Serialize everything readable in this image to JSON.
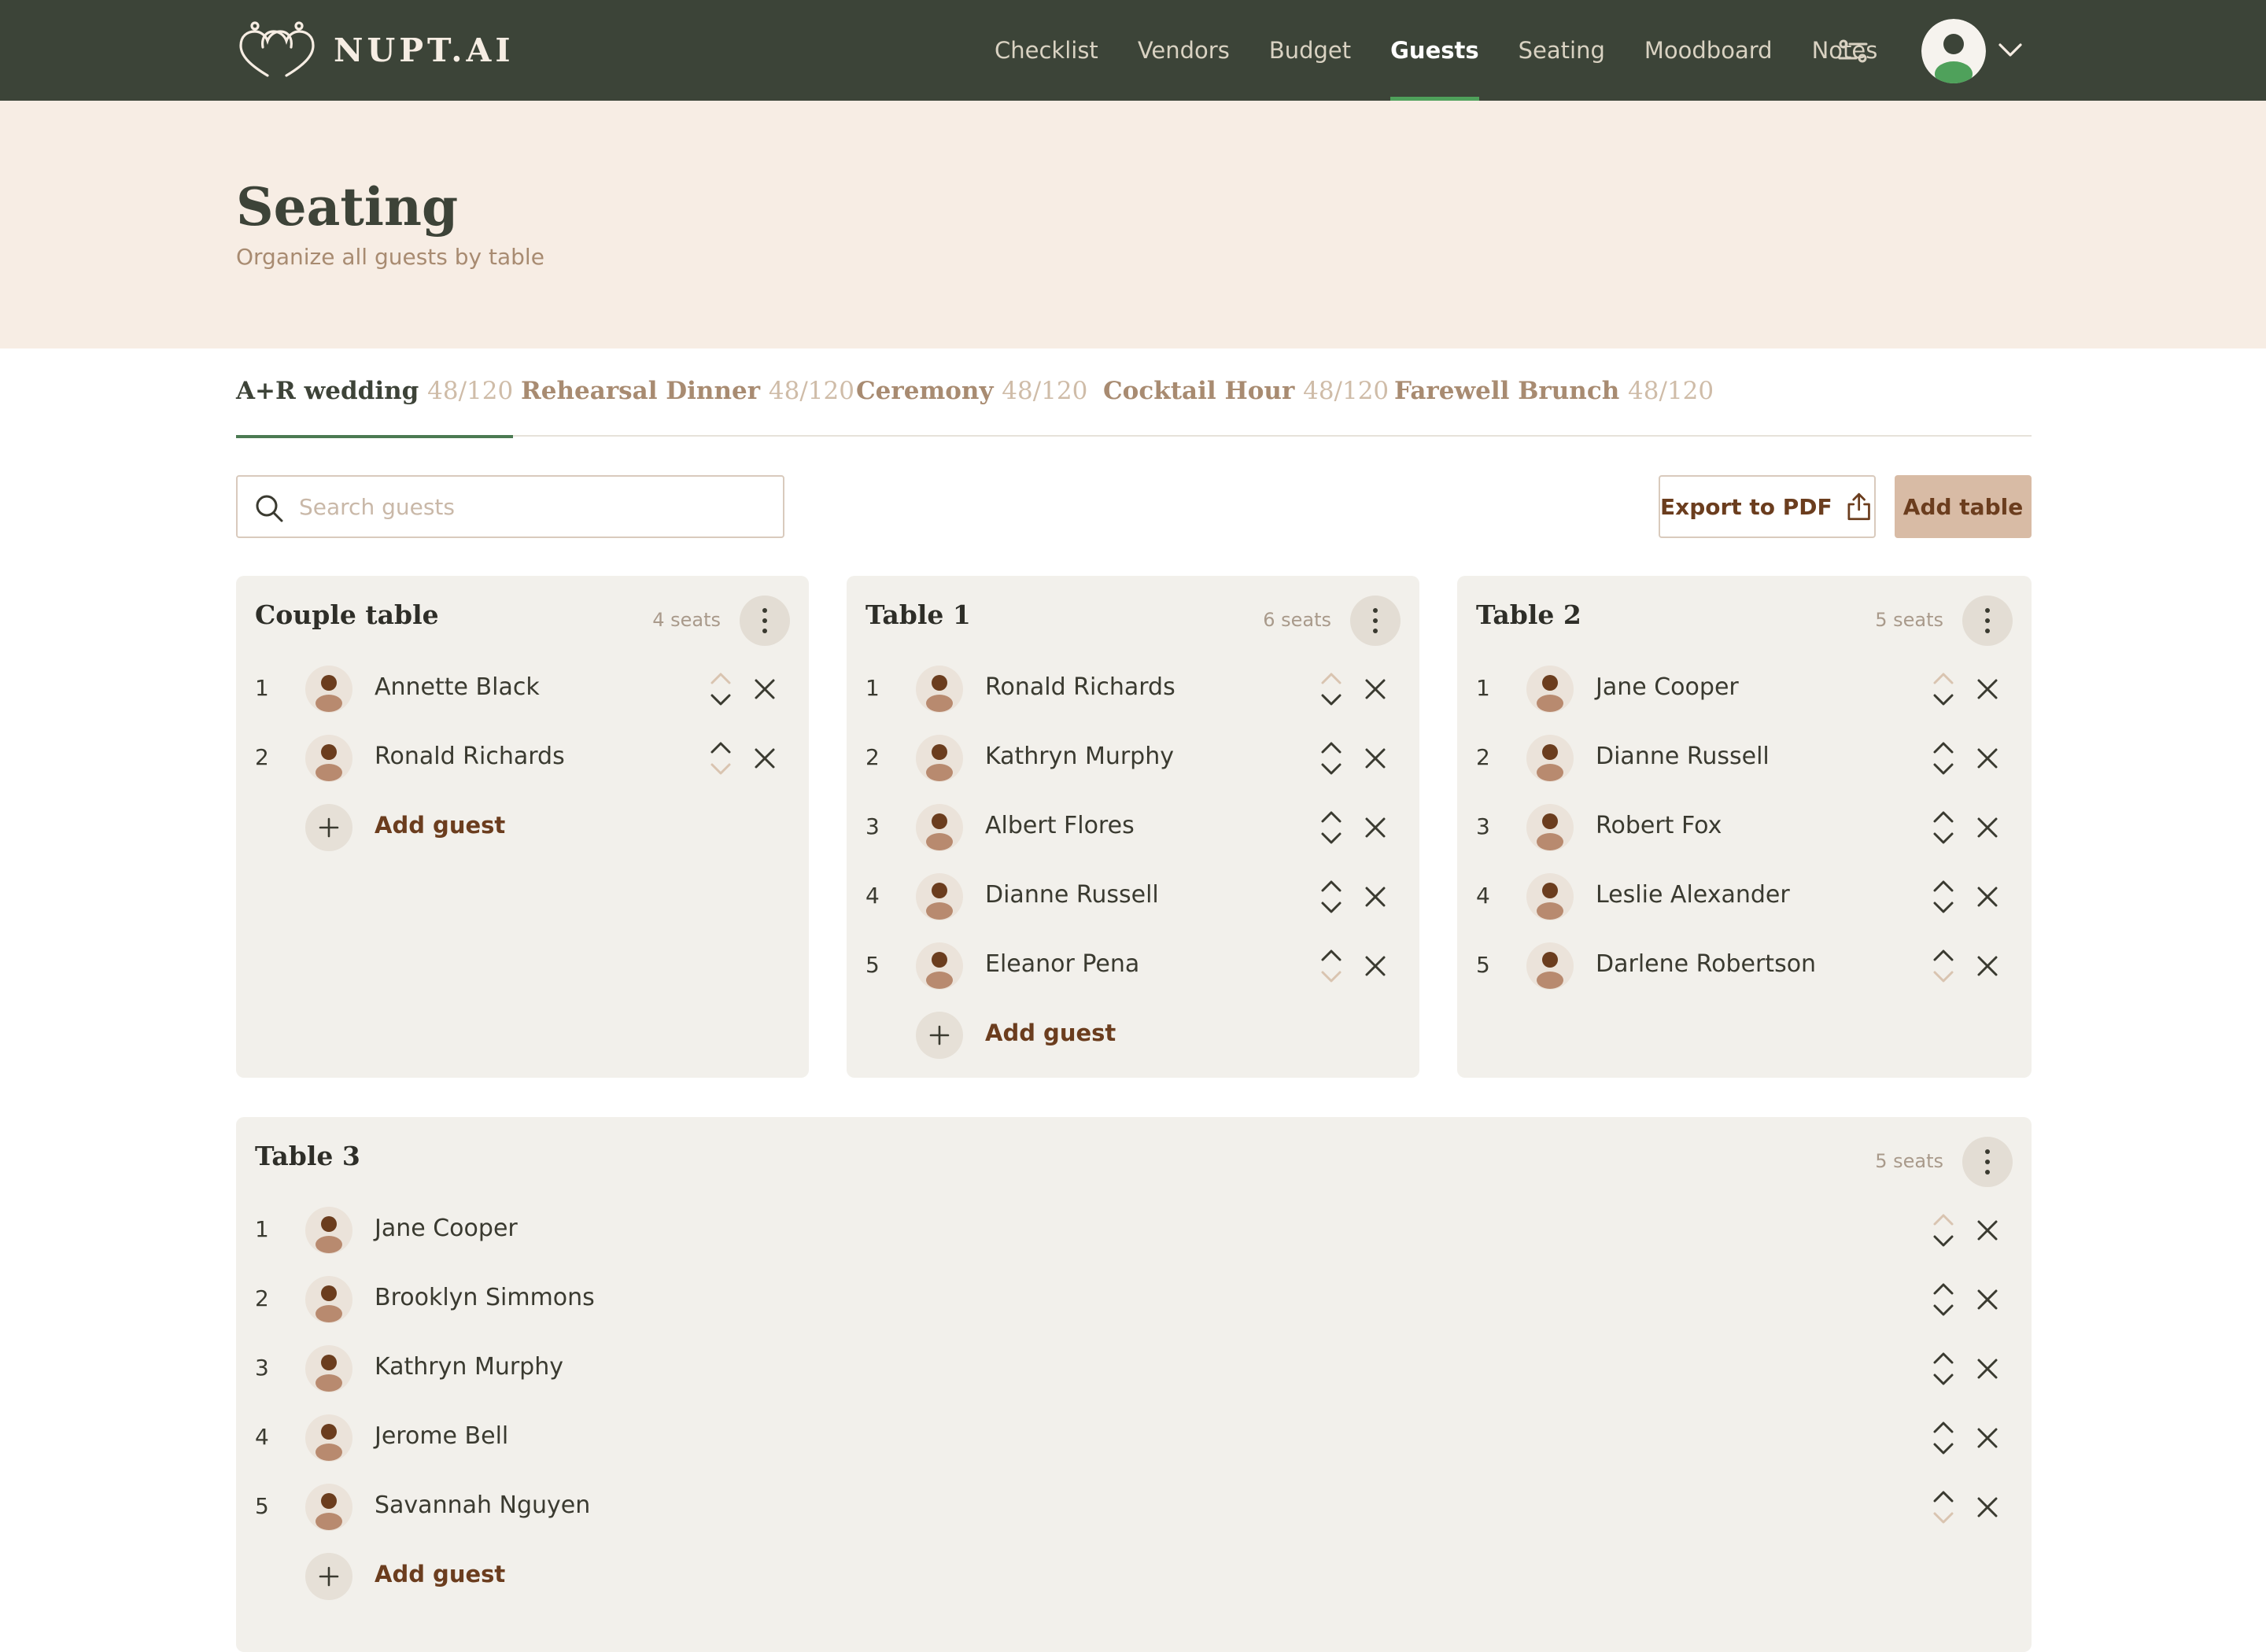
{
  "brand": {
    "name": "NUPT.AI"
  },
  "nav": {
    "items": [
      {
        "label": "Checklist",
        "active": false
      },
      {
        "label": "Vendors",
        "active": false
      },
      {
        "label": "Budget",
        "active": false
      },
      {
        "label": "Guests",
        "active": true
      },
      {
        "label": "Seating",
        "active": false
      },
      {
        "label": "Moodboard",
        "active": false
      },
      {
        "label": "Notes",
        "active": false
      }
    ]
  },
  "header": {
    "title": "Seating",
    "subtitle": "Organize all guests by table"
  },
  "tabs": [
    {
      "label": "A+R wedding",
      "count": "48/120",
      "active": true
    },
    {
      "label": "Rehearsal Dinner",
      "count": "48/120",
      "active": false
    },
    {
      "label": "Ceremony",
      "count": "48/120",
      "active": false
    },
    {
      "label": "Cocktail Hour",
      "count": "48/120",
      "active": false
    },
    {
      "label": "Farewell Brunch",
      "count": "48/120",
      "active": false
    }
  ],
  "toolbar": {
    "search_placeholder": "Search guests",
    "export_label": "Export to PDF",
    "add_table_label": "Add table"
  },
  "add_guest_label": "Add guest",
  "tables": [
    {
      "title": "Couple table",
      "seats": "4 seats",
      "guests": [
        {
          "num": "1",
          "name": "Annette Black"
        },
        {
          "num": "2",
          "name": "Ronald Richards"
        }
      ]
    },
    {
      "title": "Table 1",
      "seats": "6 seats",
      "guests": [
        {
          "num": "1",
          "name": "Ronald Richards"
        },
        {
          "num": "2",
          "name": "Kathryn Murphy"
        },
        {
          "num": "3",
          "name": "Albert Flores"
        },
        {
          "num": "4",
          "name": "Dianne Russell"
        },
        {
          "num": "5",
          "name": "Eleanor Pena"
        }
      ]
    },
    {
      "title": "Table 2",
      "seats": "5 seats",
      "guests": [
        {
          "num": "1",
          "name": "Jane Cooper"
        },
        {
          "num": "2",
          "name": "Dianne Russell"
        },
        {
          "num": "3",
          "name": "Robert Fox"
        },
        {
          "num": "4",
          "name": "Leslie Alexander"
        },
        {
          "num": "5",
          "name": "Darlene Robertson"
        }
      ]
    },
    {
      "title": "Table 3",
      "seats": "5 seats",
      "guests": [
        {
          "num": "1",
          "name": "Jane Cooper"
        },
        {
          "num": "2",
          "name": "Brooklyn Simmons"
        },
        {
          "num": "3",
          "name": "Kathryn Murphy"
        },
        {
          "num": "4",
          "name": "Jerome Bell"
        },
        {
          "num": "5",
          "name": "Savannah Nguyen"
        }
      ]
    }
  ],
  "colors": {
    "nav_bg": "#3c4438",
    "nav_active_underline": "#4fa15b",
    "hero_bg": "#f7ede4",
    "card_bg": "#f2f0eb",
    "accent_brown": "#6b3d1e",
    "button_fill": "#d8bba5"
  },
  "icons": [
    "logo-hearts-icon",
    "filter-sliders-icon",
    "user-avatar-icon",
    "chevron-down-icon",
    "search-icon",
    "share-upload-icon",
    "kebab-menu-icon",
    "reorder-arrows-icon",
    "close-icon",
    "plus-icon"
  ]
}
